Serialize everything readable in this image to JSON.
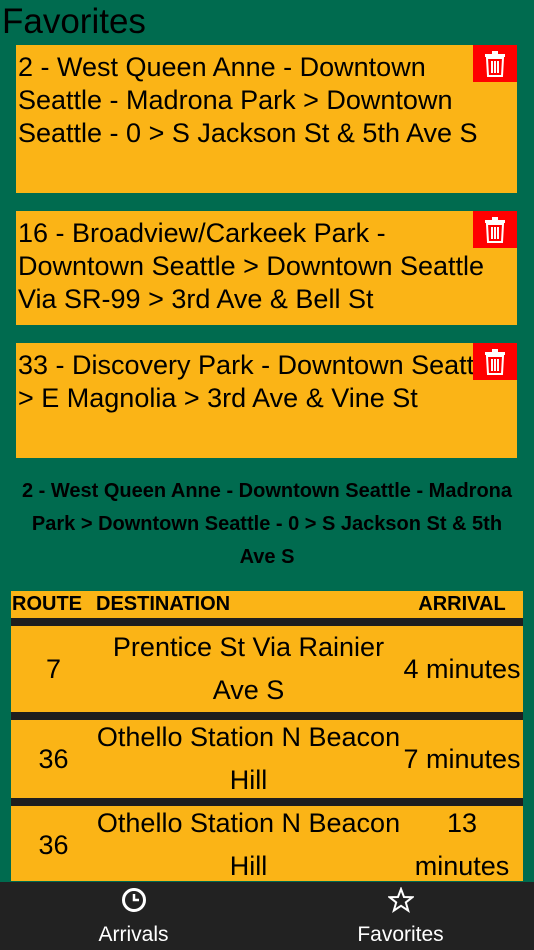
{
  "page": {
    "title": "Favorites"
  },
  "favorites": [
    {
      "text": "2 - West Queen Anne - Downtown Seattle - Madrona Park > Downtown Seattle - 0 > S Jackson St & 5th Ave S"
    },
    {
      "text": "16 - Broadview/Carkeek Park - Downtown Seattle > Downtown Seattle Via SR-99 > 3rd Ave & Bell St"
    },
    {
      "text": "33 - Discovery Park - Downtown Seattle > E Magnolia > 3rd Ave & Vine St"
    }
  ],
  "selected": {
    "title": "2 - West Queen Anne - Downtown Seattle - Madrona Park > Downtown Seattle - 0 > S Jackson St & 5th Ave S"
  },
  "arrivals_table": {
    "headers": {
      "route": "ROUTE",
      "destination": "DESTINATION",
      "arrival": "ARRIVAL"
    },
    "rows": [
      {
        "route": "7",
        "destination": "Prentice St Via Rainier Ave S",
        "arrival": "4 minutes"
      },
      {
        "route": "36",
        "destination": "Othello Station N Beacon Hill",
        "arrival": "7 minutes"
      },
      {
        "route": "36",
        "destination": "Othello Station N Beacon Hill",
        "arrival": "13 minutes"
      }
    ]
  },
  "nav": {
    "arrivals": {
      "label": "Arrivals",
      "icon": "clock-icon"
    },
    "favorites": {
      "label": "Favorites",
      "icon": "star-icon"
    }
  },
  "colors": {
    "background": "#006b4f",
    "card": "#fbb416",
    "delete": "#ff0000",
    "nav": "#222222"
  }
}
